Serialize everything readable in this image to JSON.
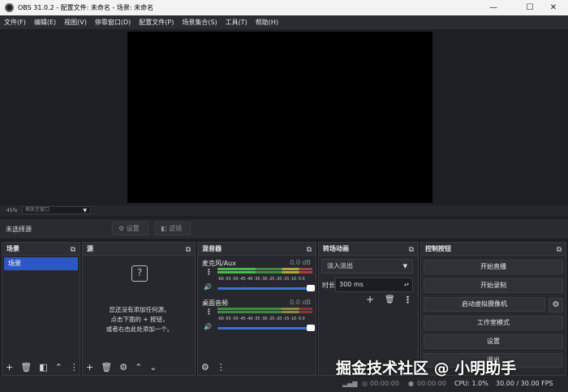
{
  "window": {
    "title": "OBS 31.0.2 - 配置文件: 未命名 - 场景: 未命名",
    "minimize": "—",
    "maximize": "☐",
    "close": "✕"
  },
  "menu": [
    "文件(F)",
    "编辑(E)",
    "视图(V)",
    "停靠窗口(D)",
    "配置文件(P)",
    "场景集合(S)",
    "工具(T)",
    "帮助(H)"
  ],
  "zoom": {
    "percent": "45%",
    "mode": "缩放至窗口"
  },
  "sourcebar": {
    "no_source": "未选择源",
    "properties": "设置",
    "filters": "滤镜"
  },
  "docks": {
    "scenes": "场景",
    "sources": "源",
    "mixer": "混音器",
    "transitions": "转场动画",
    "controls": "控制按钮"
  },
  "scenes": {
    "items": [
      "场景"
    ]
  },
  "sources": {
    "empty_line1": "您还没有添加任何源。",
    "empty_line2": "点击下面的 + 按钮，",
    "empty_line3": "或者右击此处添加一个。"
  },
  "mixer": {
    "scale": "-60 -55 -50 -45 -40 -35 -30 -25 -20 -15 -10 -5 0",
    "channels": [
      {
        "name": "麦克风/Aux",
        "db": "0.0 dB"
      },
      {
        "name": "桌面音频",
        "db": "0.0 dB"
      }
    ]
  },
  "transitions": {
    "selected": "淡入淡出",
    "duration_label": "时长",
    "duration_value": "300 ms"
  },
  "controls": {
    "start_stream": "开始直播",
    "start_record": "开始录制",
    "start_vcam": "启动虚拟摄像机",
    "studio_mode": "工作室模式",
    "settings": "设置",
    "exit": "退出"
  },
  "status": {
    "stream_time": "00:00:00",
    "rec_time": "00:00:00",
    "cpu": "CPU: 1.0%",
    "fps": "30.00 / 30.00 FPS"
  },
  "watermark": "掘金技术社区 @ 小明助手"
}
